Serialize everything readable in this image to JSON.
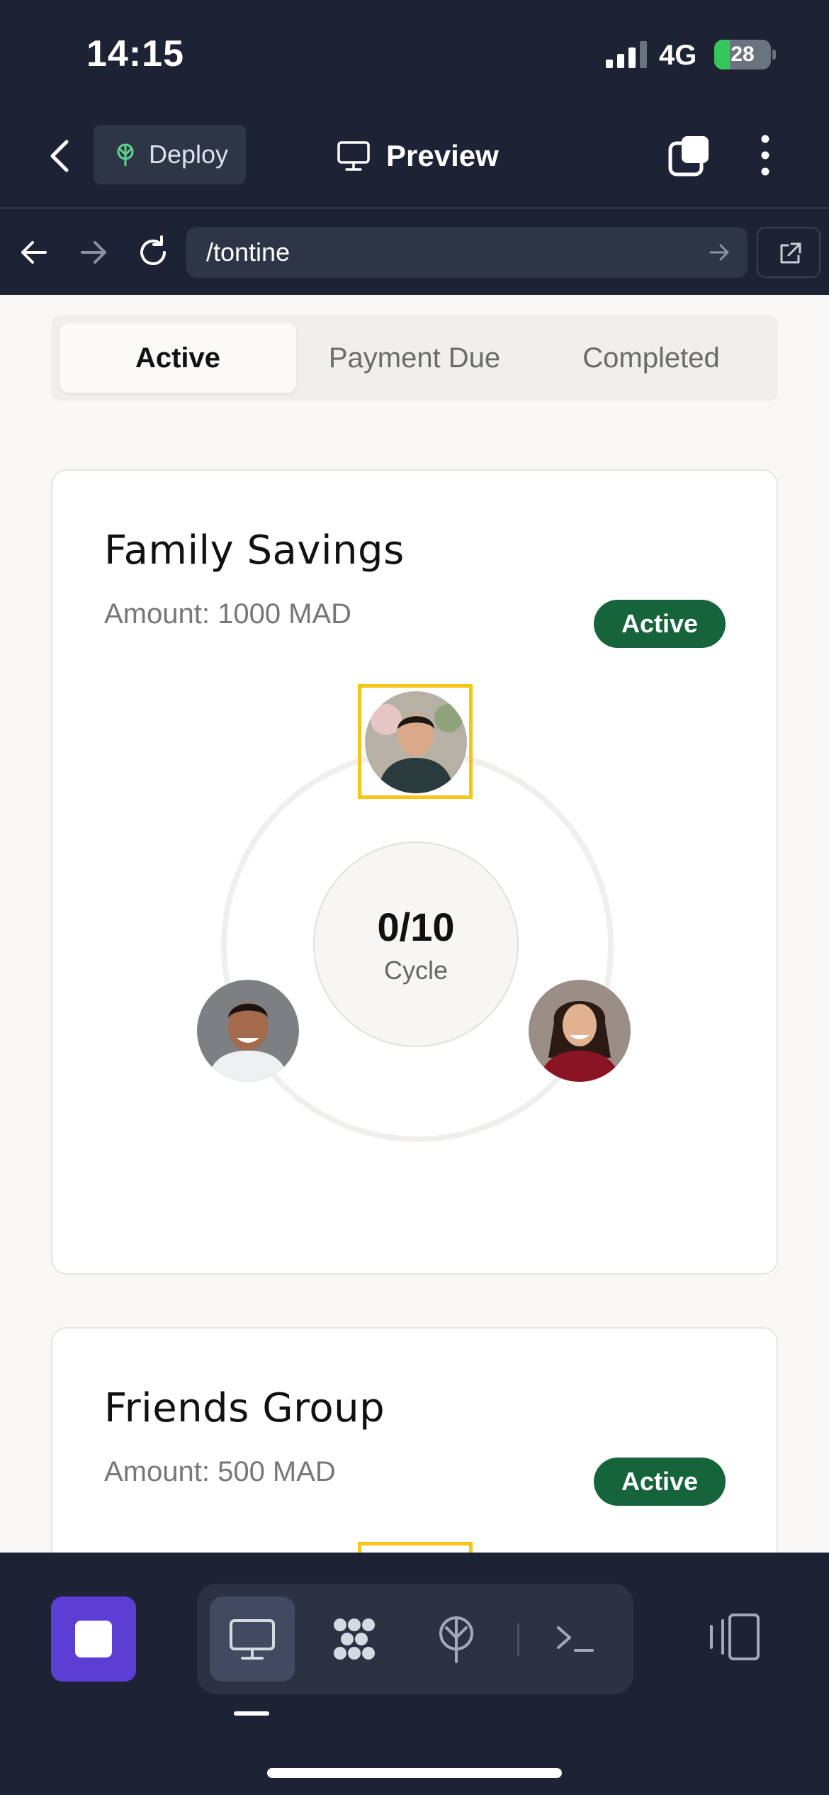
{
  "status_bar": {
    "time": "14:15",
    "network": "4G",
    "battery": "28"
  },
  "header": {
    "deploy_label": "Deploy",
    "title": "Preview"
  },
  "browser": {
    "url": "/tontine"
  },
  "tabs": [
    {
      "label": "Active",
      "selected": true
    },
    {
      "label": "Payment Due",
      "selected": false
    },
    {
      "label": "Completed",
      "selected": false
    }
  ],
  "cards": [
    {
      "title": "Family Savings",
      "amount": "Amount: 1000 MAD",
      "status": "Active",
      "cycle_value": "0/10",
      "cycle_label": "Cycle",
      "members": [
        "member-avatar-top",
        "member-avatar-left",
        "member-avatar-right"
      ]
    },
    {
      "title": "Friends Group",
      "amount": "Amount: 500 MAD",
      "status": "Active"
    }
  ],
  "toolbar": {
    "icons": [
      "stop-icon",
      "preview-icon",
      "shell-apps-icon",
      "deploy-icon",
      "terminal-icon",
      "device-toggle-icon"
    ]
  },
  "colors": {
    "chrome_bg": "#1d2334",
    "accent_purple": "#5b3fd4",
    "badge_green": "#16643a",
    "highlight_yellow": "#f5c518"
  }
}
